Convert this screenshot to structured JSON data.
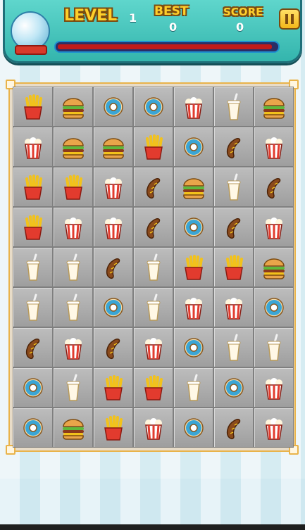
{
  "header": {
    "level_label": "LEVEL",
    "level_value": "1",
    "best_label": "BEST",
    "best_value": "0",
    "score_label": "SCORE",
    "score_value": "0",
    "pause_icon": "pause-icon",
    "progress": 0.98
  },
  "board": {
    "rows": [
      [
        "fries",
        "burger",
        "donut",
        "donut",
        "popcorn",
        "milkshake",
        "burger"
      ],
      [
        "popcorn",
        "burger",
        "burger",
        "fries",
        "donut",
        "sausage",
        "popcorn"
      ],
      [
        "fries",
        "fries",
        "popcorn",
        "sausage",
        "burger",
        "milkshake",
        "sausage"
      ],
      [
        "fries",
        "popcorn",
        "popcorn",
        "sausage",
        "donut",
        "sausage",
        "popcorn"
      ],
      [
        "milkshake",
        "milkshake",
        "sausage",
        "milkshake",
        "fries",
        "fries",
        "burger"
      ],
      [
        "milkshake",
        "milkshake",
        "donut",
        "milkshake",
        "popcorn",
        "popcorn",
        "donut"
      ],
      [
        "sausage",
        "popcorn",
        "sausage",
        "popcorn",
        "donut",
        "milkshake",
        "milkshake"
      ],
      [
        "donut",
        "milkshake",
        "fries",
        "fries",
        "milkshake",
        "donut",
        "popcorn"
      ],
      [
        "donut",
        "burger",
        "fries",
        "popcorn",
        "donut",
        "sausage",
        "popcorn"
      ]
    ]
  }
}
